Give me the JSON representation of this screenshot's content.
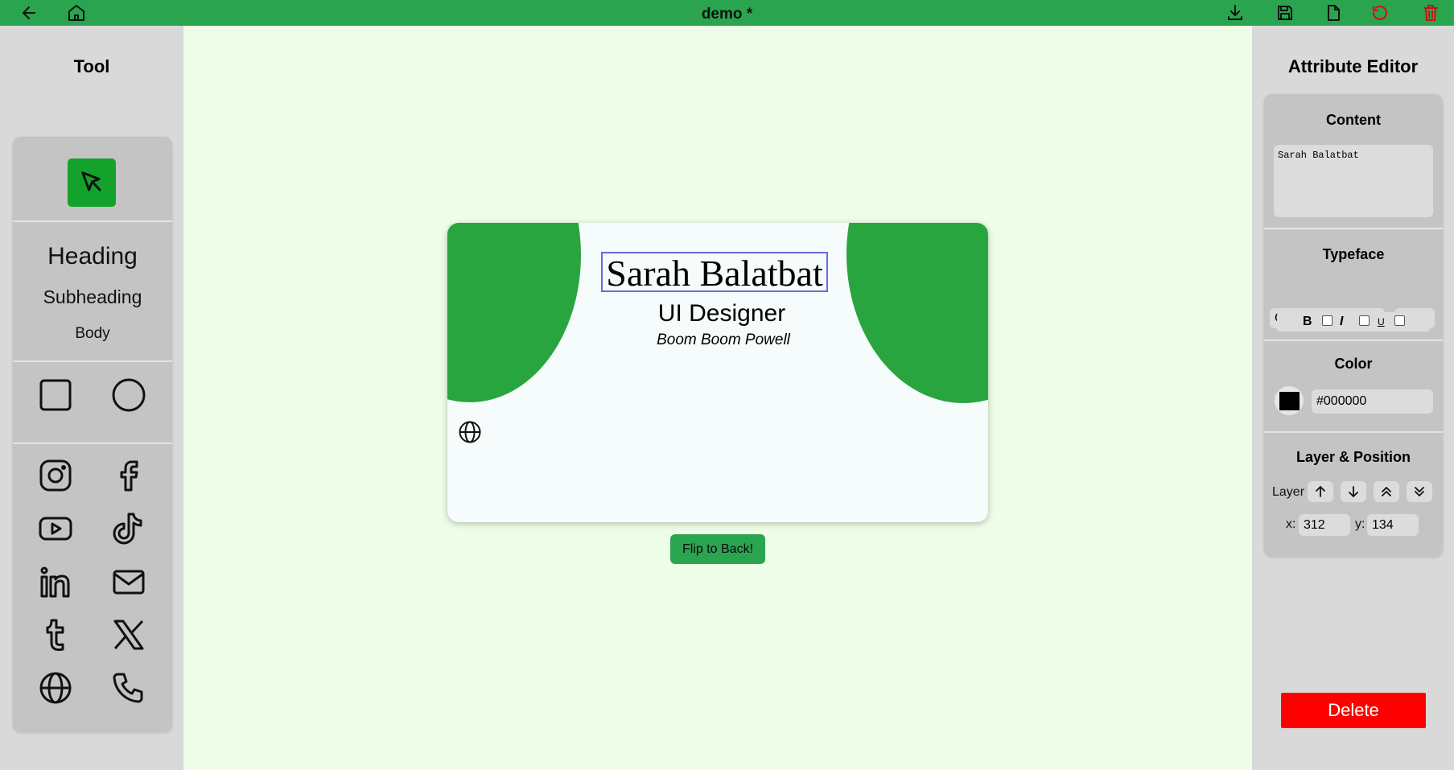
{
  "app": {
    "document_title": "demo *"
  },
  "topbar": {
    "left_icons": [
      "arrow-left-icon",
      "home-icon"
    ],
    "right_icons": [
      "download-icon",
      "save-icon",
      "new-file-icon",
      "undo-icon",
      "trash-icon"
    ]
  },
  "tool_panel": {
    "title": "Tool",
    "text_tools": {
      "heading": "Heading",
      "subheading": "Subheading",
      "body": "Body"
    },
    "shape_tools": [
      "square-icon",
      "circle-icon"
    ],
    "social_icons": [
      "instagram-icon",
      "facebook-icon",
      "youtube-icon",
      "tiktok-icon",
      "linkedin-icon",
      "mail-icon",
      "tumblr-icon",
      "x-icon",
      "globe-icon",
      "phone-icon"
    ]
  },
  "card": {
    "name": "Sarah Balatbat",
    "role": "UI Designer",
    "company": "Boom Boom Powell",
    "accent_color": "#29a540",
    "background_color": "#f6fbfb"
  },
  "flip_button": "Flip to Back!",
  "attribute_editor": {
    "title": "Attribute Editor",
    "content": {
      "title": "Content",
      "value": "Sarah Balatbat"
    },
    "typeface": {
      "title": "Typeface",
      "font": "Garamond",
      "size": "80",
      "bold_label": "B",
      "italic_label": "I",
      "underline_label": "U",
      "bold": false,
      "italic": false,
      "underline": false
    },
    "color": {
      "title": "Color",
      "hex": "#000000"
    },
    "layer_position": {
      "title": "Layer & Position",
      "layer_label": "Layer",
      "x_label": "x:",
      "y_label": "y:",
      "x": "312",
      "y": "134"
    },
    "delete_label": "Delete"
  },
  "colors": {
    "topbar": "#2aa44f",
    "canvas": "#edfde7",
    "panel": "#d9d9d9",
    "box": "#c4c4c4",
    "danger": "#ff0000",
    "active_tool": "#13a22b"
  }
}
